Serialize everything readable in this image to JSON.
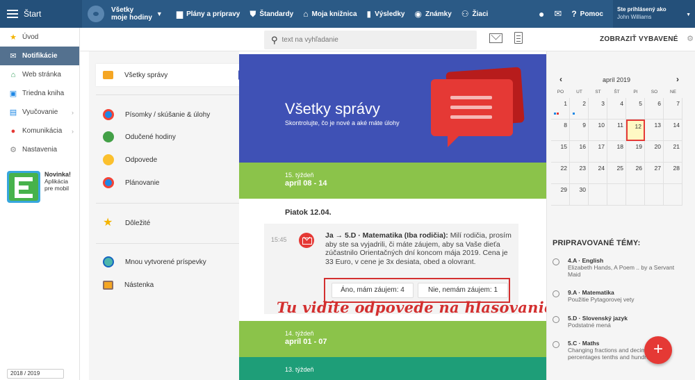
{
  "topbar": {
    "start_label": "Štart",
    "view_line1": "Všetky",
    "view_line2": "moje hodiny",
    "nav": [
      {
        "label": "Plány a prípravy",
        "icon": "briefcase-icon"
      },
      {
        "label": "Štandardy",
        "icon": "shield-icon"
      },
      {
        "label": "Moja knižnica",
        "icon": "library-icon"
      },
      {
        "label": "Výsledky",
        "icon": "bar-chart-icon"
      },
      {
        "label": "Známky",
        "icon": "grades-icon"
      },
      {
        "label": "Žiaci",
        "icon": "students-icon"
      }
    ],
    "help_label": "Pomoc",
    "user_status": "Ste prihlásený ako",
    "user_name": "John Williams"
  },
  "sidebar": {
    "items": [
      {
        "label": "Úvod",
        "icon": "star-icon"
      },
      {
        "label": "Notifikácie",
        "icon": "mail-icon"
      },
      {
        "label": "Web stránka",
        "icon": "home-icon"
      },
      {
        "label": "Triedna kniha",
        "icon": "book-icon"
      },
      {
        "label": "Vyučovanie",
        "icon": "teaching-icon"
      },
      {
        "label": "Komunikácia",
        "icon": "chat-icon"
      },
      {
        "label": "Nastavenia",
        "icon": "gear-icon"
      }
    ],
    "promo_title": "Novinka!",
    "promo_line1": "Aplikácia",
    "promo_line2": "pre mobil",
    "year_label": "2018 / 2019"
  },
  "subbar": {
    "search_placeholder": "text na vyhľadanie",
    "show_selected": "ZOBRAZIŤ VYBAVENÉ"
  },
  "categories": {
    "selected": "Všetky správy",
    "group1": [
      "Písomky / skúšanie & úlohy",
      "Odučené hodiny",
      "Odpovede",
      "Plánovanie"
    ],
    "important": "Dôležité",
    "group2": [
      "Mnou vytvorené príspevky",
      "Nástenka"
    ]
  },
  "feed": {
    "hero_title": "Všetky správy",
    "hero_subtitle": "Skontrolujte, čo je nové a aké máte úlohy",
    "week15_label": "15. týždeň",
    "week15_range": "apríl 08 - 14",
    "day_label": "Piatok 12.04.",
    "message": {
      "time": "15:45",
      "header": "Ja → 5.D · Matematika (Iba rodičia):",
      "body": " Milí rodičia, prosím aby ste sa vyjadrili, či máte záujem, aby sa Vaše dieťa zúčastnilo Orientačných dní koncom mája 2019. Cena je 33 Euro, v cene je 3x desiata, obed a olovrant.",
      "poll_yes": "Áno, mám záujem: 4",
      "poll_no": "Nie, nemám záujem: 1"
    },
    "annotation": "Tu vidíte odpovede na hlasovanie",
    "week14_label": "14. týždeň",
    "week14_range": "apríl 01 - 07",
    "week13_label": "13. týždeň"
  },
  "calendar": {
    "month": "apríl 2019",
    "weekdays": [
      "PO",
      "UT",
      "ST",
      "ŠT",
      "PI",
      "SO",
      "NE"
    ],
    "weeks": [
      [
        "1",
        "2",
        "3",
        "4",
        "5",
        "6",
        "7"
      ],
      [
        "8",
        "9",
        "10",
        "11",
        "12",
        "13",
        "14"
      ],
      [
        "15",
        "16",
        "17",
        "18",
        "19",
        "20",
        "21"
      ],
      [
        "22",
        "23",
        "24",
        "25",
        "26",
        "27",
        "28"
      ],
      [
        "29",
        "30",
        "",
        "",
        "",
        "",
        ""
      ]
    ],
    "today": "12"
  },
  "topics": {
    "title": "PRIPRAVOVANÉ TÉMY:",
    "items": [
      {
        "class": "4.A · English",
        "text": "Elizabeth Hands, A Poem .. by a Servant Maid"
      },
      {
        "class": "9.A · Matematika",
        "text": "Použitie Pytagorovej vety"
      },
      {
        "class": "5.D · Slovenský jazyk",
        "text": "Podstatné mená"
      },
      {
        "class": "5.C · Maths",
        "text": "Changing fractions and decimals, percentages tenths and hundredths"
      }
    ]
  },
  "colors": {
    "topbar": "#2b5a86",
    "hero": "#3f51b5",
    "week_green": "#8bc34a",
    "week_teal": "#1e9e78",
    "accent_red": "#e53935"
  }
}
